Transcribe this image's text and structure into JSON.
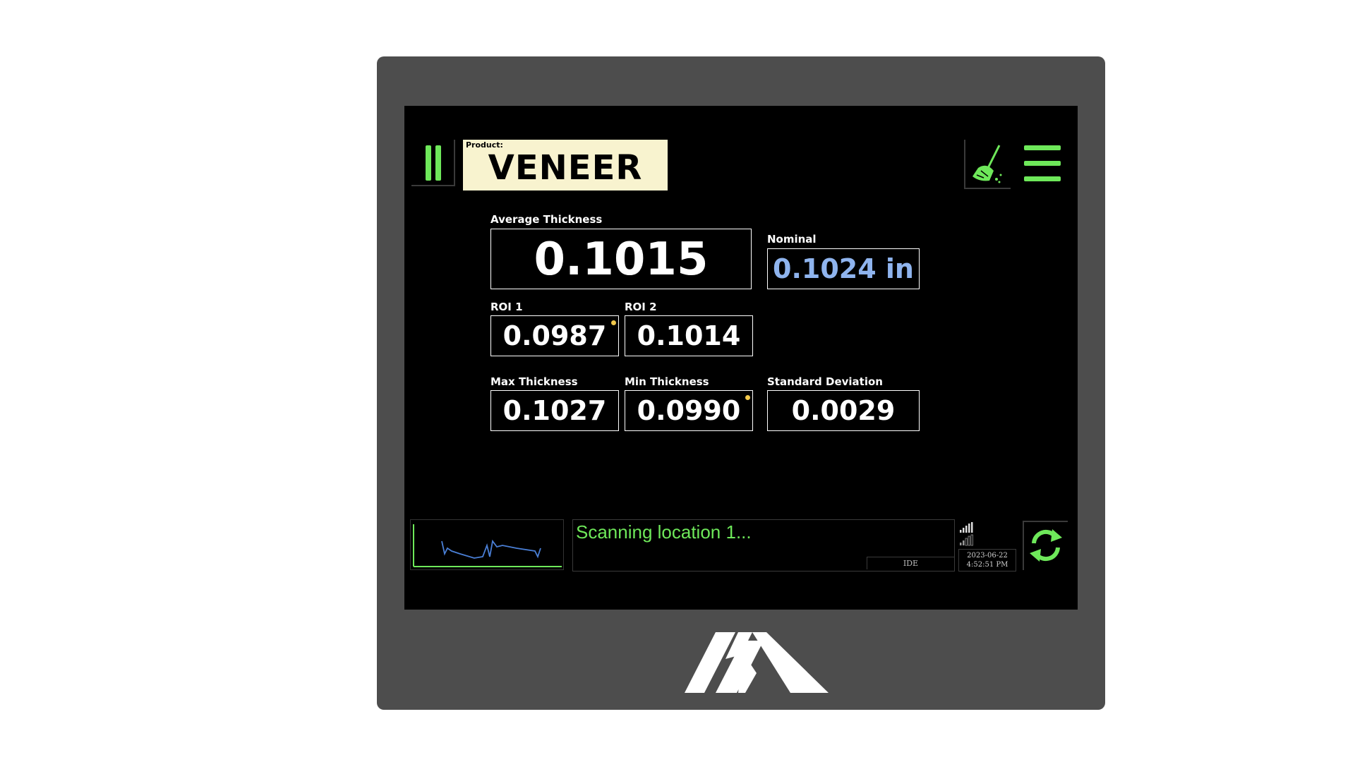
{
  "header": {
    "product_label": "Product:",
    "product_name": "VENEER"
  },
  "metrics": {
    "average_thickness": {
      "label": "Average Thickness",
      "value": "0.1015"
    },
    "nominal": {
      "label": "Nominal",
      "value": "0.1024 in"
    },
    "roi1": {
      "label": "ROI 1",
      "value": "0.0987"
    },
    "roi2": {
      "label": "ROI 2",
      "value": "0.1014"
    },
    "max_thickness": {
      "label": "Max Thickness",
      "value": "0.1027"
    },
    "min_thickness": {
      "label": "Min Thickness",
      "value": "0.0990"
    },
    "std_dev": {
      "label": "Standard Deviation",
      "value": "0.0029"
    }
  },
  "status": {
    "message": "Scanning location 1...",
    "mode": "IDE",
    "date": "2023-06-22",
    "time": "4:52:51 PM"
  },
  "colors": {
    "accent_green": "#6ee85a",
    "nominal_blue": "#8fb4ee",
    "product_bg": "#f8f3cf",
    "indicator_yellow": "#f2c84b",
    "trend_line": "#4a7fd6"
  },
  "icons": {
    "pause": "pause-icon",
    "broom": "broom-icon",
    "menu": "hamburger-menu-icon",
    "signal": "signal-strength-icon",
    "refresh": "refresh-icon"
  }
}
